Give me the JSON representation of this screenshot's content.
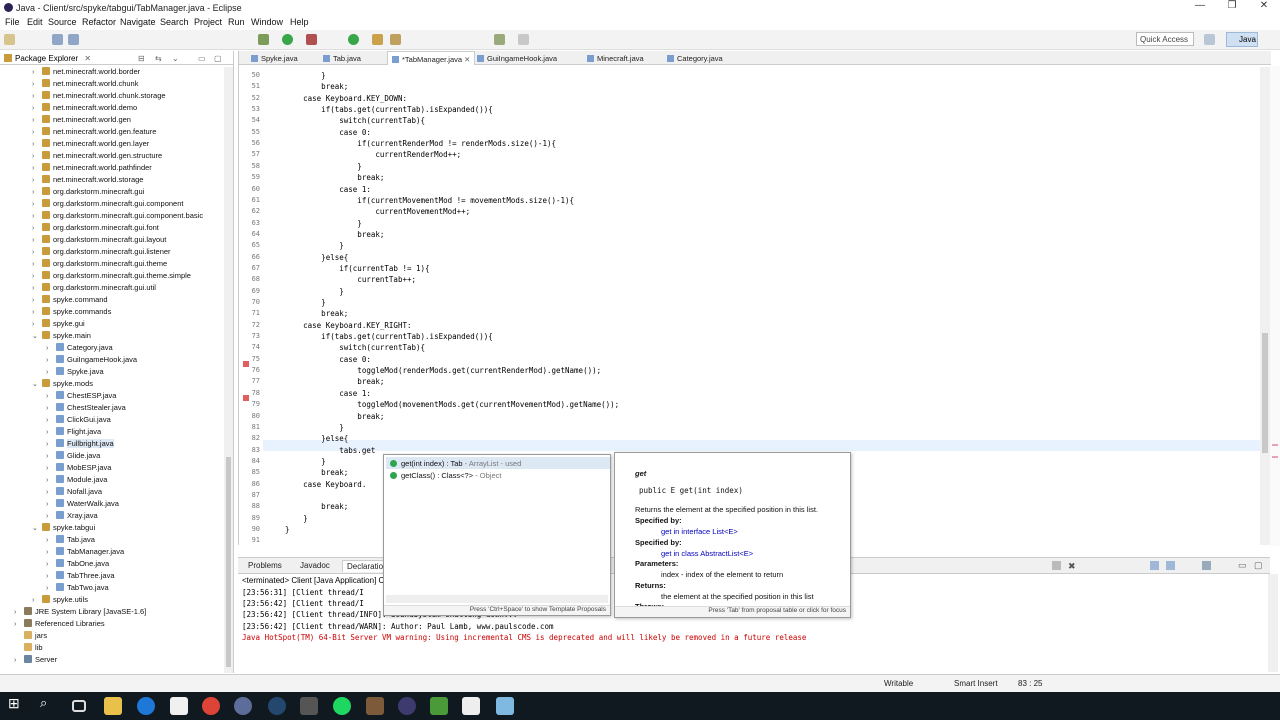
{
  "window": {
    "title": "Java - Client/src/spyke/tabgui/TabManager.java - Eclipse",
    "minimize": "—",
    "maximize": "❐",
    "close": "✕"
  },
  "menu": [
    "File",
    "Edit",
    "Source",
    "Refactor",
    "Navigate",
    "Search",
    "Project",
    "Run",
    "Window",
    "Help"
  ],
  "quick_access": {
    "placeholder": "Quick Access"
  },
  "perspective": "Java",
  "package_explorer": {
    "title": "Package Explorer",
    "nodes": [
      {
        "label": "net.minecraft.world.border",
        "indent": 1,
        "kind": "pkg",
        "tw": "›"
      },
      {
        "label": "net.minecraft.world.chunk",
        "indent": 1,
        "kind": "pkg",
        "tw": "›"
      },
      {
        "label": "net.minecraft.world.chunk.storage",
        "indent": 1,
        "kind": "pkg",
        "tw": "›"
      },
      {
        "label": "net.minecraft.world.demo",
        "indent": 1,
        "kind": "pkg",
        "tw": "›"
      },
      {
        "label": "net.minecraft.world.gen",
        "indent": 1,
        "kind": "pkg",
        "tw": "›"
      },
      {
        "label": "net.minecraft.world.gen.feature",
        "indent": 1,
        "kind": "pkg",
        "tw": "›"
      },
      {
        "label": "net.minecraft.world.gen.layer",
        "indent": 1,
        "kind": "pkg",
        "tw": "›"
      },
      {
        "label": "net.minecraft.world.gen.structure",
        "indent": 1,
        "kind": "pkg",
        "tw": "›"
      },
      {
        "label": "net.minecraft.world.pathfinder",
        "indent": 1,
        "kind": "pkg",
        "tw": "›"
      },
      {
        "label": "net.minecraft.world.storage",
        "indent": 1,
        "kind": "pkg",
        "tw": "›"
      },
      {
        "label": "org.darkstorm.minecraft.gui",
        "indent": 1,
        "kind": "pkg",
        "tw": "›"
      },
      {
        "label": "org.darkstorm.minecraft.gui.component",
        "indent": 1,
        "kind": "pkg",
        "tw": "›"
      },
      {
        "label": "org.darkstorm.minecraft.gui.component.basic",
        "indent": 1,
        "kind": "pkg",
        "tw": "›"
      },
      {
        "label": "org.darkstorm.minecraft.gui.font",
        "indent": 1,
        "kind": "pkg",
        "tw": "›"
      },
      {
        "label": "org.darkstorm.minecraft.gui.layout",
        "indent": 1,
        "kind": "pkg",
        "tw": "›"
      },
      {
        "label": "org.darkstorm.minecraft.gui.listener",
        "indent": 1,
        "kind": "pkg",
        "tw": "›"
      },
      {
        "label": "org.darkstorm.minecraft.gui.theme",
        "indent": 1,
        "kind": "pkg",
        "tw": "›"
      },
      {
        "label": "org.darkstorm.minecraft.gui.theme.simple",
        "indent": 1,
        "kind": "pkg",
        "tw": "›"
      },
      {
        "label": "org.darkstorm.minecraft.gui.util",
        "indent": 1,
        "kind": "pkg",
        "tw": "›"
      },
      {
        "label": "spyke.command",
        "indent": 1,
        "kind": "pkg",
        "tw": "›"
      },
      {
        "label": "spyke.commands",
        "indent": 1,
        "kind": "pkg",
        "tw": "›"
      },
      {
        "label": "spyke.gui",
        "indent": 1,
        "kind": "pkg",
        "tw": "›"
      },
      {
        "label": "spyke.main",
        "indent": 1,
        "kind": "pkg",
        "tw": "⌄"
      },
      {
        "label": "Category.java",
        "indent": 2,
        "kind": "jf",
        "tw": "›"
      },
      {
        "label": "GuiIngameHook.java",
        "indent": 2,
        "kind": "jf",
        "tw": "›"
      },
      {
        "label": "Spyke.java",
        "indent": 2,
        "kind": "jf",
        "tw": "›"
      },
      {
        "label": "spyke.mods",
        "indent": 1,
        "kind": "pkg",
        "tw": "⌄"
      },
      {
        "label": "ChestESP.java",
        "indent": 2,
        "kind": "jf",
        "tw": "›"
      },
      {
        "label": "ChestStealer.java",
        "indent": 2,
        "kind": "jf",
        "tw": "›"
      },
      {
        "label": "ClickGui.java",
        "indent": 2,
        "kind": "jf",
        "tw": "›"
      },
      {
        "label": "Flight.java",
        "indent": 2,
        "kind": "jf",
        "tw": "›"
      },
      {
        "label": "Fullbright.java",
        "indent": 2,
        "kind": "jf",
        "tw": "›"
      },
      {
        "label": "Glide.java",
        "indent": 2,
        "kind": "jf",
        "tw": "›"
      },
      {
        "label": "MobESP.java",
        "indent": 2,
        "kind": "jf",
        "tw": "›"
      },
      {
        "label": "Module.java",
        "indent": 2,
        "kind": "jf",
        "tw": "›"
      },
      {
        "label": "Nofall.java",
        "indent": 2,
        "kind": "jf",
        "tw": "›"
      },
      {
        "label": "WaterWalk.java",
        "indent": 2,
        "kind": "jf",
        "tw": "›"
      },
      {
        "label": "Xray.java",
        "indent": 2,
        "kind": "jf",
        "tw": "›"
      },
      {
        "label": "spyke.tabgui",
        "indent": 1,
        "kind": "pkg",
        "tw": "⌄"
      },
      {
        "label": "Tab.java",
        "indent": 2,
        "kind": "jf",
        "tw": "›"
      },
      {
        "label": "TabManager.java",
        "indent": 2,
        "kind": "jf",
        "tw": "›"
      },
      {
        "label": "TabOne.java",
        "indent": 2,
        "kind": "jf",
        "tw": "›"
      },
      {
        "label": "TabThree.java",
        "indent": 2,
        "kind": "jf",
        "tw": "›"
      },
      {
        "label": "TabTwo.java",
        "indent": 2,
        "kind": "jf",
        "tw": "›"
      },
      {
        "label": "spyke.utils",
        "indent": 1,
        "kind": "pkg",
        "tw": "›"
      },
      {
        "label": "JRE System Library [JavaSE-1.6]",
        "indent": 0,
        "kind": "lib",
        "tw": "›"
      },
      {
        "label": "Referenced Libraries",
        "indent": 0,
        "kind": "lib",
        "tw": "›"
      },
      {
        "label": "jars",
        "indent": 0,
        "kind": "fold",
        "tw": ""
      },
      {
        "label": "lib",
        "indent": 0,
        "kind": "fold",
        "tw": ""
      },
      {
        "label": "Server",
        "indent": 0,
        "kind": "srv",
        "tw": "›"
      }
    ]
  },
  "editor_tabs": [
    {
      "label": "Spyke.java",
      "active": false
    },
    {
      "label": "Tab.java",
      "active": false
    },
    {
      "label": "*TabManager.java",
      "active": true
    },
    {
      "label": "GuiIngameHook.java",
      "active": false
    },
    {
      "label": "Minecraft.java",
      "active": false
    },
    {
      "label": "Category.java",
      "active": false
    }
  ],
  "code_lines": [
    {
      "n": "50",
      "t": "            }"
    },
    {
      "n": "51",
      "t": "            break;"
    },
    {
      "n": "52",
      "t": "        case Keyboard.KEY_DOWN:"
    },
    {
      "n": "53",
      "t": "            if(tabs.get(currentTab).isExpanded()){"
    },
    {
      "n": "54",
      "t": "                switch(currentTab){"
    },
    {
      "n": "55",
      "t": "                case 0:"
    },
    {
      "n": "56",
      "t": "                    if(currentRenderMod != renderMods.size()-1){"
    },
    {
      "n": "57",
      "t": "                        currentRenderMod++;"
    },
    {
      "n": "58",
      "t": "                    }"
    },
    {
      "n": "59",
      "t": "                    break;"
    },
    {
      "n": "60",
      "t": "                case 1:"
    },
    {
      "n": "61",
      "t": "                    if(currentMovementMod != movementMods.size()-1){"
    },
    {
      "n": "62",
      "t": "                        currentMovementMod++;"
    },
    {
      "n": "63",
      "t": "                    }"
    },
    {
      "n": "64",
      "t": "                    break;"
    },
    {
      "n": "65",
      "t": "                }"
    },
    {
      "n": "66",
      "t": "            }else{"
    },
    {
      "n": "67",
      "t": "                if(currentTab != 1){"
    },
    {
      "n": "68",
      "t": "                    currentTab++;"
    },
    {
      "n": "69",
      "t": "                }"
    },
    {
      "n": "70",
      "t": "            }"
    },
    {
      "n": "71",
      "t": "            break;"
    },
    {
      "n": "72",
      "t": "        case Keyboard.KEY_RIGHT:"
    },
    {
      "n": "73",
      "t": "            if(tabs.get(currentTab).isExpanded()){"
    },
    {
      "n": "74",
      "t": "                switch(currentTab){"
    },
    {
      "n": "75",
      "t": "                case 0:"
    },
    {
      "n": "76",
      "t": "                    toggleMod(renderMods.get(currentRenderMod).getName());"
    },
    {
      "n": "77",
      "t": "                    break;"
    },
    {
      "n": "78",
      "t": "                case 1:"
    },
    {
      "n": "79",
      "t": "                    toggleMod(movementMods.get(currentMovementMod).getName());"
    },
    {
      "n": "80",
      "t": "                    break;"
    },
    {
      "n": "81",
      "t": "                }"
    },
    {
      "n": "82",
      "t": "            }else{"
    },
    {
      "n": "83",
      "t": "                tabs.get"
    },
    {
      "n": "84",
      "t": "            }"
    },
    {
      "n": "85",
      "t": "            break;"
    },
    {
      "n": "86",
      "t": "        case Keyboard."
    },
    {
      "n": "87",
      "t": ""
    },
    {
      "n": "88",
      "t": "            break;"
    },
    {
      "n": "89",
      "t": "        }"
    },
    {
      "n": "90",
      "t": "    }"
    },
    {
      "n": "91",
      "t": ""
    }
  ],
  "content_assist": {
    "items": [
      {
        "name": "get(int index) : Tab",
        "ret": " - ArrayList - used"
      },
      {
        "name": "getClass() : Class<?>",
        "ret": " - Object"
      }
    ],
    "footer": "Press 'Ctrl+Space' to show Template Proposals"
  },
  "javadoc": {
    "name": "get",
    "signature": "public E get(int index)",
    "description": "Returns the element at the specified position in this list.",
    "specified_by_1_label": "Specified by:",
    "specified_by_1": "get in interface List<E>",
    "specified_by_2_label": "Specified by:",
    "specified_by_2": "get in class AbstractList<E>",
    "params_label": "Parameters:",
    "param": "index - index of the element to return",
    "returns_label": "Returns:",
    "returns": "the element at the specified position in this list",
    "throws_label": "Throws:",
    "footer": "Press 'Tab' from proposal table or click for focus"
  },
  "console": {
    "tabs": [
      "Problems",
      "Javadoc",
      "Declaration"
    ],
    "header": "<terminated> Client [Java Application] C",
    "lines": [
      {
        "t": "[23:56:31] [Client thread/I",
        "err": false
      },
      {
        "t": "[23:56:42] [Client thread/I",
        "err": false
      },
      {
        "t": "[23:56:42] [Client thread/INFO]: SoundSystem shutting down...",
        "err": false
      },
      {
        "t": "[23:56:42] [Client thread/WARN]: Author: Paul Lamb, www.paulscode.com",
        "err": false
      },
      {
        "t": "Java HotSpot(TM) 64-Bit Server VM warning: Using incremental CMS is deprecated and will likely be removed in a future release",
        "err": true
      }
    ]
  },
  "status": {
    "writable": "Writable",
    "insert": "Smart Insert",
    "position": "83 : 25"
  }
}
